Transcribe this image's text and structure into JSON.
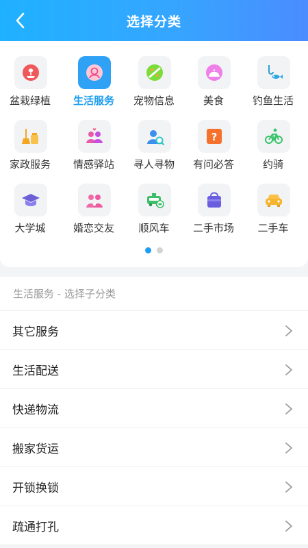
{
  "header": {
    "title": "选择分类"
  },
  "categories": {
    "rows": [
      [
        {
          "label": "盆栽绿植",
          "icon": "potted-plant-icon",
          "active": false
        },
        {
          "label": "生活服务",
          "icon": "life-service-icon",
          "active": true
        },
        {
          "label": "宠物信息",
          "icon": "pet-icon",
          "active": false
        },
        {
          "label": "美食",
          "icon": "food-dish-icon",
          "active": false
        },
        {
          "label": "钓鱼生活",
          "icon": "fishing-icon",
          "active": false
        }
      ],
      [
        {
          "label": "家政服务",
          "icon": "housekeeping-icon",
          "active": false
        },
        {
          "label": "情感驿站",
          "icon": "emotion-icon",
          "active": false
        },
        {
          "label": "寻人寻物",
          "icon": "search-person-icon",
          "active": false
        },
        {
          "label": "有问必答",
          "icon": "question-icon",
          "active": false
        },
        {
          "label": "约骑",
          "icon": "bicycle-icon",
          "active": false
        }
      ],
      [
        {
          "label": "大学城",
          "icon": "graduation-cap-icon",
          "active": false
        },
        {
          "label": "婚恋交友",
          "icon": "couple-icon",
          "active": false
        },
        {
          "label": "顺风车",
          "icon": "taxi-icon",
          "active": false
        },
        {
          "label": "二手市场",
          "icon": "shopping-bag-icon",
          "active": false
        },
        {
          "label": "二手车",
          "icon": "car-icon",
          "active": false
        }
      ]
    ],
    "page_dots": {
      "count": 2,
      "active": 1
    }
  },
  "subcategory": {
    "heading": "生活服务 - 选择子分类",
    "items": [
      "其它服务",
      "生活配送",
      "快递物流",
      "搬家货运",
      "开锁换锁",
      "疏通打孔"
    ]
  },
  "colors": {
    "header_start": "#1fb1ff",
    "header_end": "#4b8cff",
    "accent": "#1a9cf0"
  }
}
